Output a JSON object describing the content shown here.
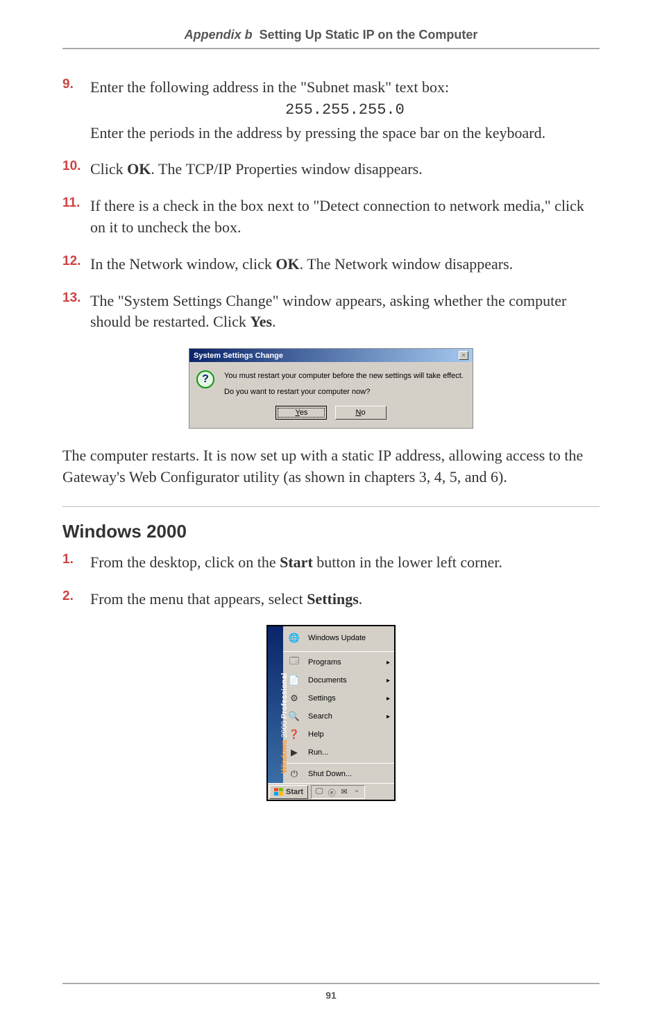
{
  "header": {
    "italic_part": "Appendix b",
    "bold_part": "Setting Up Static IP on the Computer"
  },
  "steps_a": [
    {
      "num": "9.",
      "lines": {
        "l1": "Enter the following address in the \"Subnet mask\" text box:",
        "mono": "255.255.255.0",
        "l2": "Enter the periods in the address by pressing the space bar on the keyboard."
      }
    },
    {
      "num": "10.",
      "text_a": "Click ",
      "bold": "OK",
      "text_b": ". The ",
      "sc": "TCP/IP",
      "text_c": " Properties window disappears."
    },
    {
      "num": "11.",
      "text": "If there is a check in the box next to \"Detect connection to network media,\" click on it to uncheck the box."
    },
    {
      "num": "12.",
      "text_a": "In the Network window, click ",
      "bold": "OK",
      "text_b": ". The Network window disappears."
    },
    {
      "num": "13.",
      "text_a": "The \"System Settings Change\" window appears, asking whether the computer should be restarted. Click ",
      "bold": "Yes",
      "text_b": "."
    }
  ],
  "dialog1": {
    "title": "System Settings Change",
    "close": "×",
    "msg1": "You must restart your computer before the new settings will take effect.",
    "msg2": "Do you want to restart your computer now?",
    "yes": "Yes",
    "no": "No",
    "yes_u": "Y",
    "no_u": "N"
  },
  "para1_a": "The computer restarts. It is now set up with a static ",
  "para1_sc": "IP",
  "para1_b": " address, allowing access to the Gateway's Web Configurator utility (as shown in chapters 3, 4, 5, and 6).",
  "section_title": "Windows 2000",
  "steps_b": [
    {
      "num": "1.",
      "text_a": "From the desktop, click on the ",
      "bold": "Start",
      "text_b": " button in the lower left corner."
    },
    {
      "num": "2.",
      "text_a": "From the menu that appears, select ",
      "bold": "Settings",
      "text_b": "."
    }
  ],
  "startmenu": {
    "side_a": "Windows",
    "side_b": "2000",
    "side_c": "Professional",
    "items": {
      "windows_update": "Windows Update",
      "programs": "Programs",
      "documents": "Documents",
      "settings": "Settings",
      "search": "Search",
      "help": "Help",
      "run": "Run...",
      "shutdown": "Shut Down..."
    },
    "start": "Start"
  },
  "page_number": "91"
}
